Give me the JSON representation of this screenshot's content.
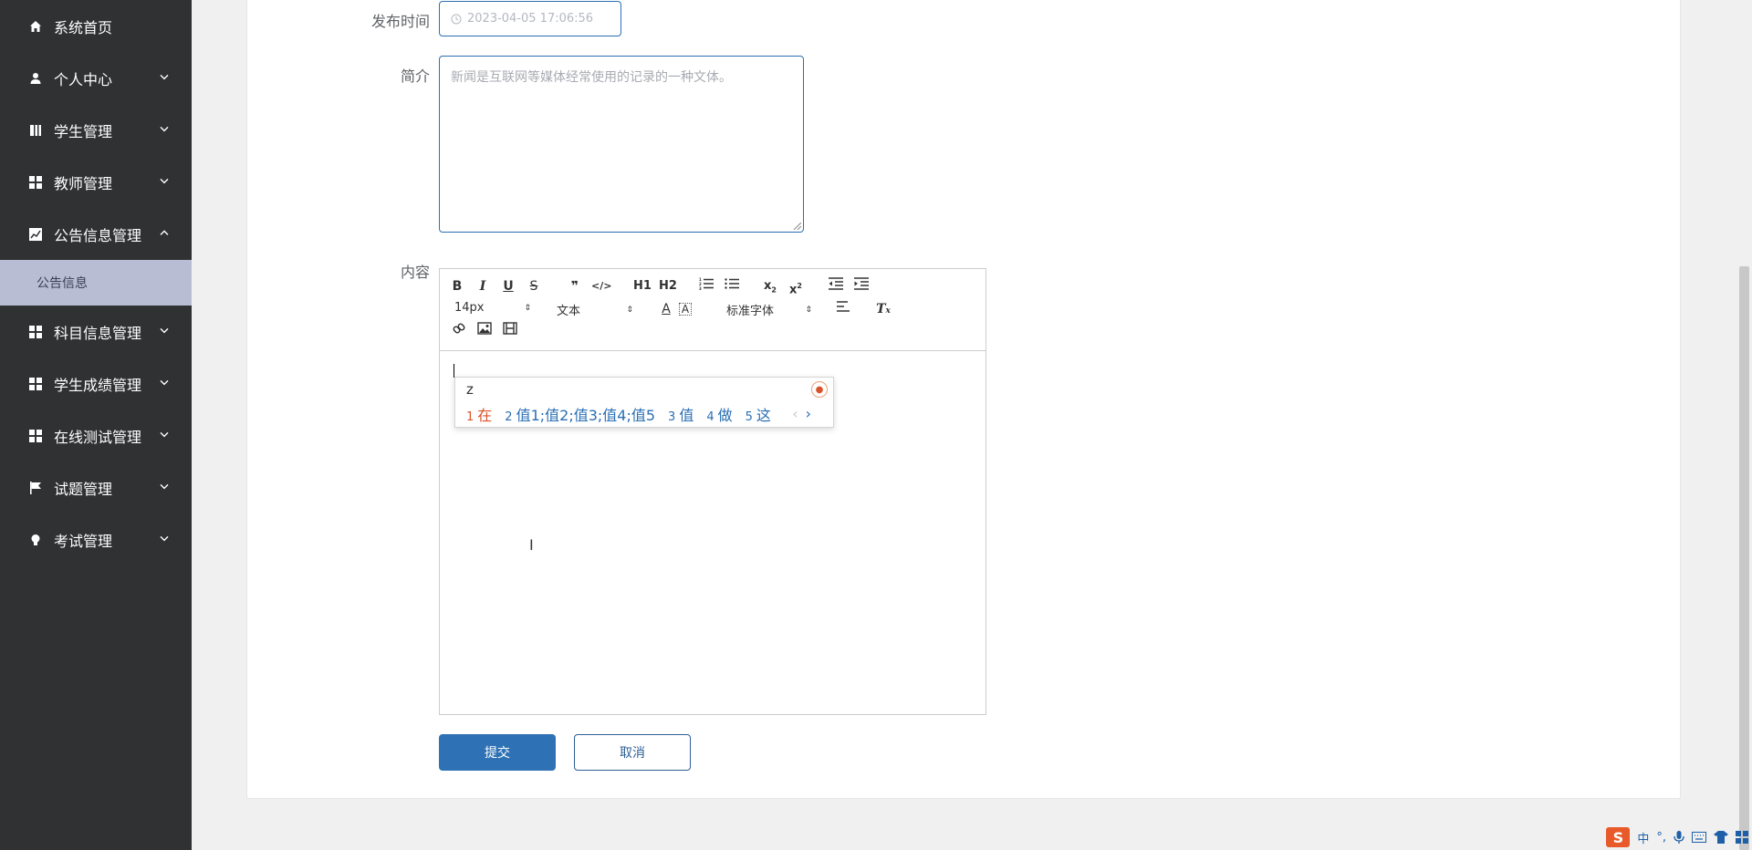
{
  "sidebar": {
    "items": [
      {
        "label": "系统首页",
        "icon": "home-icon"
      },
      {
        "label": "个人中心",
        "icon": "user-icon"
      },
      {
        "label": "学生管理",
        "icon": "book-icon"
      },
      {
        "label": "教师管理",
        "icon": "grid-icon"
      },
      {
        "label": "公告信息管理",
        "icon": "chart-icon"
      },
      {
        "label": "科目信息管理",
        "icon": "grid-icon"
      },
      {
        "label": "学生成绩管理",
        "icon": "grid-icon"
      },
      {
        "label": "在线测试管理",
        "icon": "grid-icon"
      },
      {
        "label": "试题管理",
        "icon": "flag-icon"
      },
      {
        "label": "考试管理",
        "icon": "bulb-icon"
      }
    ],
    "active_sub": "公告信息"
  },
  "form": {
    "publish_time_label": "发布时间",
    "publish_time_value": "2023-04-05 17:06:56",
    "intro_label": "简介",
    "intro_placeholder": "新闻是互联网等媒体经常使用的记录的一种文体。",
    "content_label": "内容",
    "submit": "提交",
    "cancel": "取消"
  },
  "toolbar": {
    "font_size": "14px",
    "header_select": "文本",
    "font_family": "标准字体",
    "h1": "H1",
    "h2": "H2"
  },
  "ime": {
    "typed": "z",
    "candidates": [
      {
        "n": "1",
        "text": "在"
      },
      {
        "n": "2",
        "text": "值1;值2;值3;值4;值5"
      },
      {
        "n": "3",
        "text": "值"
      },
      {
        "n": "4",
        "text": "做"
      },
      {
        "n": "5",
        "text": "这"
      }
    ]
  },
  "tray": {
    "lang": "中"
  },
  "colors": {
    "sidebar_bg": "#2f3133",
    "active_sub_bg": "#b8bdd3",
    "primary": "#2e72b5"
  }
}
